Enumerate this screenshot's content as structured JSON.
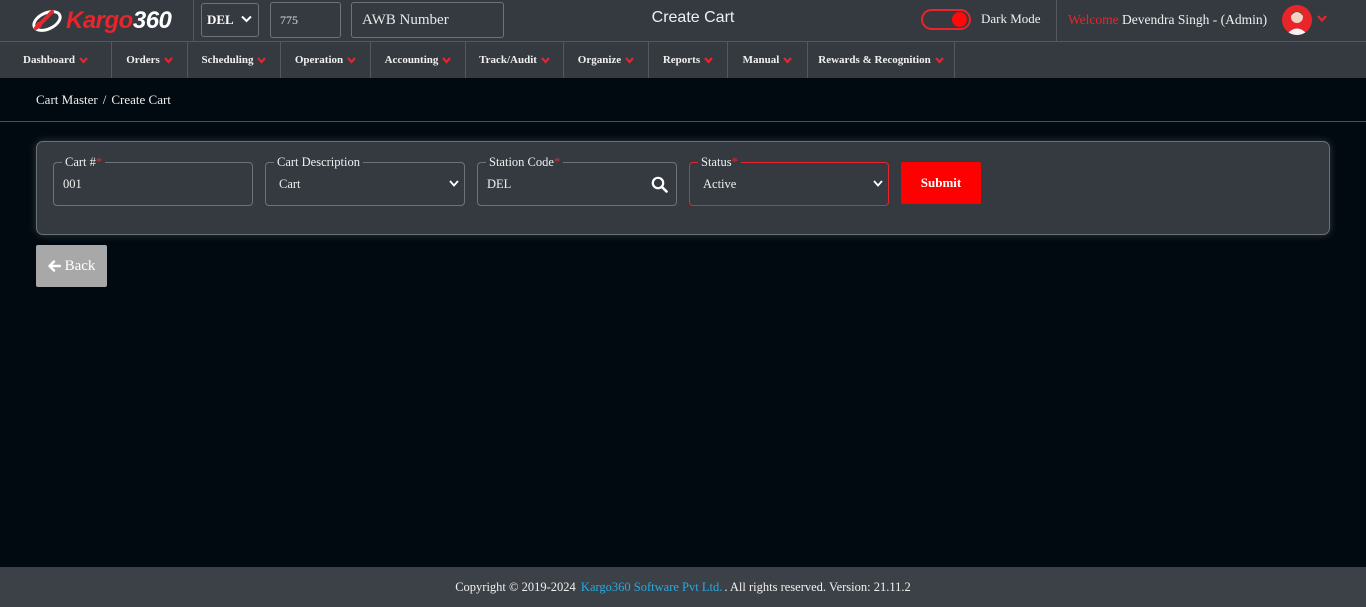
{
  "header": {
    "logo": {
      "brand_part1": "Kargo",
      "brand_part2": "360"
    },
    "station_select": {
      "value": "DEL"
    },
    "awb_prefix": {
      "value": "775"
    },
    "awb_number": {
      "placeholder": "AWB Number"
    },
    "page_title": "Create Cart",
    "dark_mode": {
      "label": "Dark Mode",
      "on": true
    },
    "welcome": {
      "label": "Welcome",
      "user": "Devendra Singh - (Admin)"
    },
    "avatar_icon": "user-avatar-icon"
  },
  "menu": [
    {
      "label": "Dashboard"
    },
    {
      "label": "Orders"
    },
    {
      "label": "Scheduling"
    },
    {
      "label": "Operation"
    },
    {
      "label": "Accounting"
    },
    {
      "label": "Track/Audit"
    },
    {
      "label": "Organize"
    },
    {
      "label": "Reports"
    },
    {
      "label": "Manual"
    },
    {
      "label": "Rewards & Recognition"
    }
  ],
  "breadcrumb": {
    "parent": "Cart Master",
    "separator": "/",
    "current": "Create Cart"
  },
  "form": {
    "cart_no": {
      "label": "Cart #",
      "required": "*",
      "value": "001"
    },
    "cart_description": {
      "label": "Cart Description",
      "value": "Cart"
    },
    "station_code": {
      "label": "Station Code",
      "required": "*",
      "value": "DEL"
    },
    "status": {
      "label": "Status",
      "required": "*",
      "value": "Active"
    },
    "submit_label": "Submit"
  },
  "back_label": "Back",
  "footer": {
    "prefix": "Copyright © 2019-2024",
    "company": "Kargo360 Software Pvt Ltd.",
    "suffix": ". All rights reserved. Version: 21.11.2"
  },
  "colors": {
    "accent_red": "#e8252b",
    "background": "#020a11",
    "panel": "#343a40",
    "link": "#29a8e0"
  }
}
